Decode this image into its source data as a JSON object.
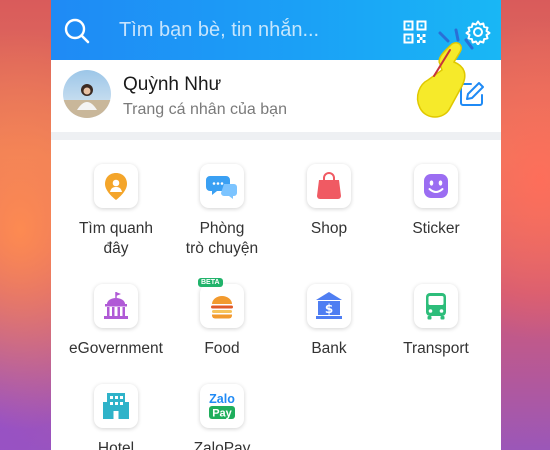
{
  "header": {
    "search_placeholder": "Tìm bạn bè, tin nhắn...",
    "icons": [
      "search-icon",
      "qr-code-icon",
      "gear-icon"
    ]
  },
  "profile": {
    "name": "Quỳnh Như",
    "subtitle": "Trang cá nhân của bạn"
  },
  "apps": [
    {
      "label_line1": "Tìm quanh",
      "label_line2": "đây",
      "icon": "location-person-icon",
      "color": "#f4a52a"
    },
    {
      "label_line1": "Phòng",
      "label_line2": "trò chuyện",
      "icon": "chat-bubbles-icon",
      "color": "#3aa0f3"
    },
    {
      "label_line1": "Shop",
      "label_line2": "",
      "icon": "shopping-bag-icon",
      "color": "#f05a63"
    },
    {
      "label_line1": "Sticker",
      "label_line2": "",
      "icon": "smiley-icon",
      "color": "#9b6df2"
    },
    {
      "label_line1": "eGovernment",
      "label_line2": "",
      "icon": "government-building-icon",
      "color": "#b05ad6"
    },
    {
      "label_line1": "Food",
      "label_line2": "",
      "icon": "burger-icon",
      "color": "#f29a2e",
      "badge": "BETA"
    },
    {
      "label_line1": "Bank",
      "label_line2": "",
      "icon": "bank-icon",
      "color": "#4f7ef2"
    },
    {
      "label_line1": "Transport",
      "label_line2": "",
      "icon": "bus-icon",
      "color": "#2dbd7a"
    },
    {
      "label_line1": "Hotel",
      "label_line2": "",
      "icon": "hotel-icon",
      "color": "#2fb3c9"
    },
    {
      "label_line1": "ZaloPay",
      "label_line2": "",
      "icon": "zalopay-icon",
      "color": "#1fae5c",
      "logo_line1": "Zalo",
      "logo_line2": "Pay"
    }
  ]
}
